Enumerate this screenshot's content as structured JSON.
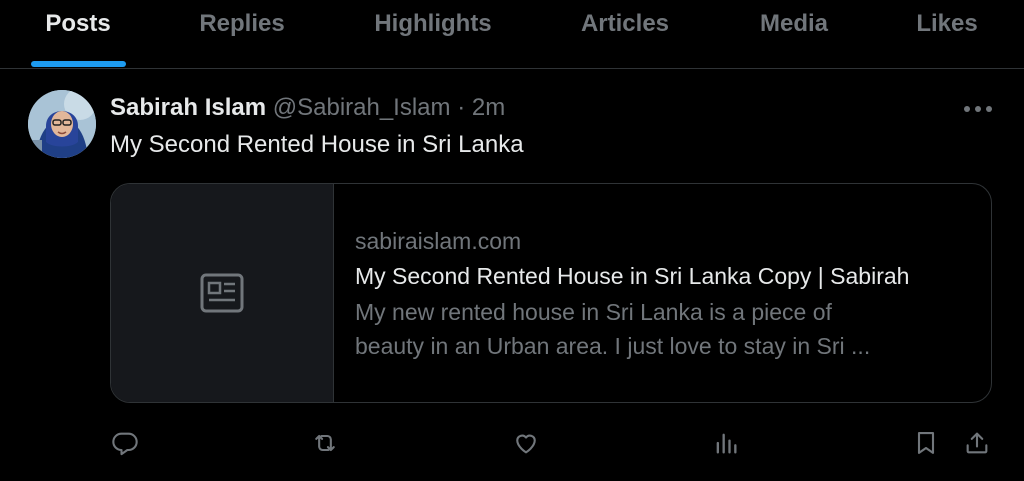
{
  "tabs": [
    {
      "label": "Posts",
      "active": true
    },
    {
      "label": "Replies"
    },
    {
      "label": "Highlights"
    },
    {
      "label": "Articles"
    },
    {
      "label": "Media"
    },
    {
      "label": "Likes"
    }
  ],
  "post": {
    "author_name": "Sabirah Islam",
    "author_handle": "@Sabirah_Islam",
    "separator": "·",
    "time": "2m",
    "text": "My Second Rented House in Sri Lanka",
    "more_icon": "more-horizontal-icon",
    "link_card": {
      "domain": "sabiraislam.com",
      "title": "My Second Rented House in Sri Lanka Copy | Sabirah",
      "description": "My new rented house in Sri Lanka is a piece of\nbeauty in an Urban area. I just love to stay in Sri ...",
      "thumbnail_icon": "article-icon"
    },
    "actions": [
      {
        "name": "reply",
        "icon": "reply-icon"
      },
      {
        "name": "repost",
        "icon": "repost-icon"
      },
      {
        "name": "like",
        "icon": "like-icon"
      },
      {
        "name": "views",
        "icon": "views-icon"
      },
      {
        "name": "bookmark",
        "icon": "bookmark-icon"
      },
      {
        "name": "share",
        "icon": "share-icon"
      }
    ]
  },
  "colors": {
    "background": "#000000",
    "accent": "#1d9bf0",
    "primary_text": "#e7e9ea",
    "secondary_text": "#71767b",
    "border": "#2f3336"
  }
}
